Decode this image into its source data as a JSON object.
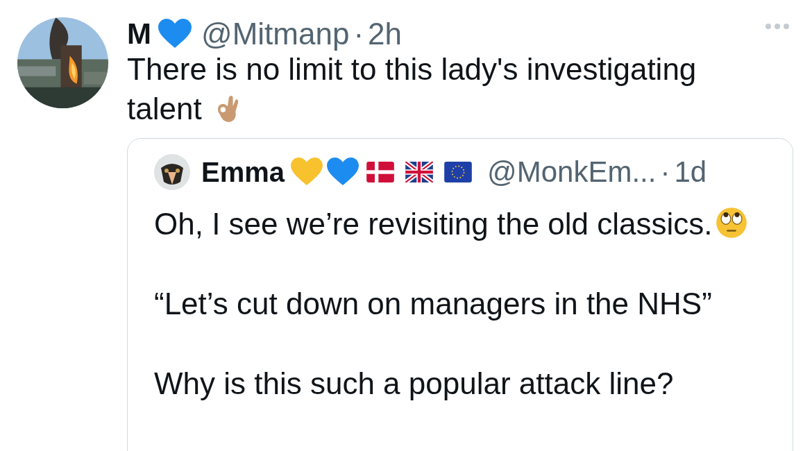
{
  "tweet": {
    "author": {
      "name": "M",
      "badges": [
        {
          "kind": "heart",
          "color": "#1d8cf0"
        }
      ]
    },
    "handle": "@Mitmanp",
    "separator": "·",
    "time": "2h",
    "text": "There is no limit to this lady's investigating talent",
    "quote": {
      "author": {
        "name": "Emma",
        "badges": [
          {
            "kind": "heart",
            "color": "#f8c22e"
          },
          {
            "kind": "heart",
            "color": "#1d8cf0"
          },
          {
            "kind": "flag-dk"
          },
          {
            "kind": "flag-uk"
          },
          {
            "kind": "flag-eu"
          }
        ]
      },
      "handle": "@MonkEm...",
      "separator": "·",
      "time": "1d",
      "paragraphs": [
        {
          "kind": "with-emoji",
          "text": "Oh, I see we’re revisiting the old classics."
        },
        {
          "kind": "plain",
          "text": "“Let’s cut down on managers in the NHS”"
        },
        {
          "kind": "plain",
          "text": "Why is this such a popular attack line?"
        }
      ]
    }
  }
}
